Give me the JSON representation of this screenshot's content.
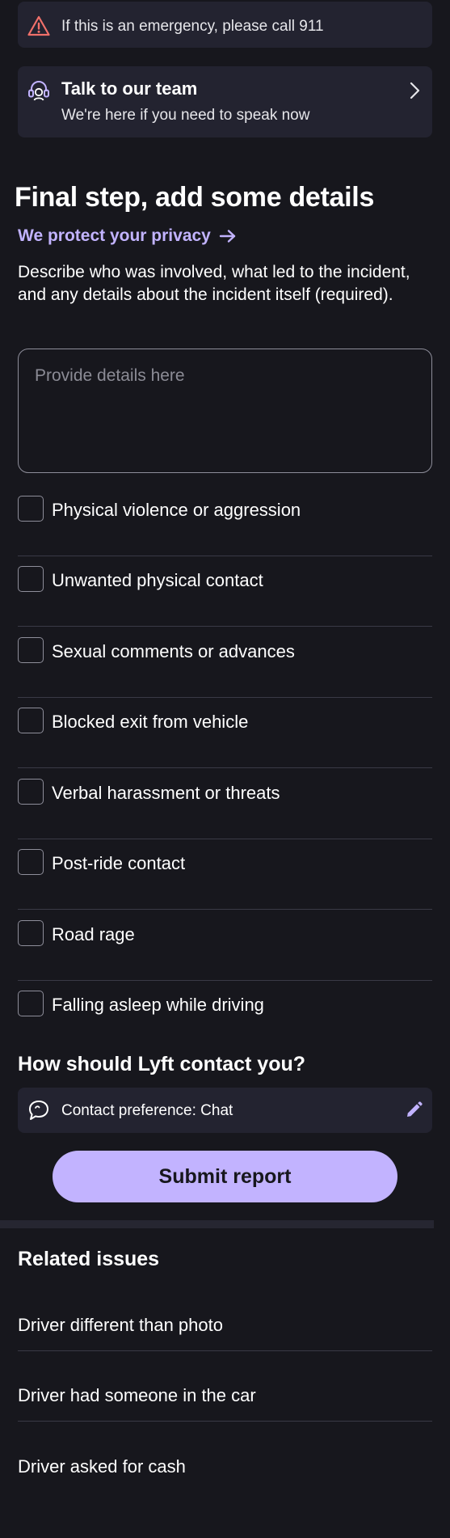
{
  "emergency_banner": {
    "icon": "warning-triangle-icon",
    "text": "If this is an emergency, please call 911",
    "icon_color": "#f0706a"
  },
  "team_banner": {
    "icon": "headset-support-icon",
    "title": "Talk to our team",
    "subtitle": "We're here if you need to speak now",
    "chevron": "chevron-right-icon"
  },
  "details": {
    "title": "Final step, add some details",
    "privacy_link": "We protect your privacy",
    "privacy_arrow": "arrow-right-icon",
    "description": "Describe who was involved, what led to the incident, and any details about the incident itself (required).",
    "input_placeholder": "Provide details here",
    "input_value": ""
  },
  "incident_types": [
    {
      "label": "Physical violence or aggression",
      "checked": false
    },
    {
      "label": "Unwanted physical contact",
      "checked": false
    },
    {
      "label": "Sexual comments or advances",
      "checked": false
    },
    {
      "label": "Blocked exit from vehicle",
      "checked": false
    },
    {
      "label": "Verbal harassment or threats",
      "checked": false
    },
    {
      "label": "Post-ride contact",
      "checked": false
    },
    {
      "label": "Road rage",
      "checked": false
    },
    {
      "label": "Falling asleep while driving",
      "checked": false
    }
  ],
  "contact": {
    "heading": "How should Lyft contact you?",
    "icon": "chat-bubble-icon",
    "preference_text": "Contact preference: Chat",
    "edit_icon": "pencil-edit-icon"
  },
  "submit": {
    "label": "Submit report"
  },
  "related": {
    "heading": "Related issues",
    "items": [
      {
        "label": "Driver different than photo"
      },
      {
        "label": "Driver had someone in the car"
      },
      {
        "label": "Driver asked for cash"
      }
    ]
  },
  "colors": {
    "background": "#17171d",
    "card": "#232330",
    "accent": "#c2b3ff",
    "divider": "#3a3a46",
    "warning": "#f0706a"
  }
}
